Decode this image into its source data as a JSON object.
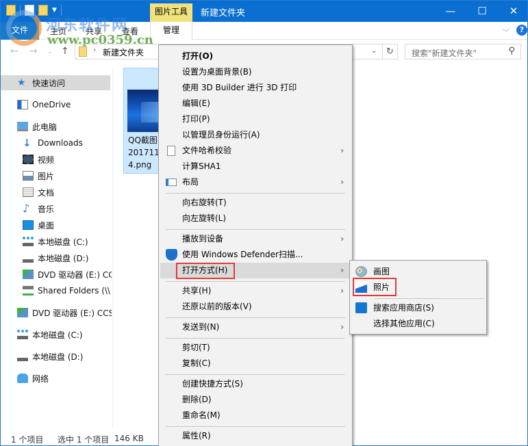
{
  "window": {
    "title": "新建文件夹",
    "contextual_tab_group": "图片工具",
    "controls": {
      "minimize": "—",
      "maximize": "☐",
      "close": "✕"
    }
  },
  "ribbon": {
    "tabs": [
      {
        "label": "文件"
      },
      {
        "label": "主页"
      },
      {
        "label": "共享"
      },
      {
        "label": "查看"
      },
      {
        "label": "管理"
      }
    ],
    "expand_icon": "chevron-down-icon",
    "help_label": "?"
  },
  "address_bar": {
    "path": [
      "新建文件夹"
    ],
    "separator": "›",
    "refresh": "↻",
    "search_placeholder": "搜索\"新建文件夹\""
  },
  "nav_pane": {
    "items": [
      {
        "label": "快速访问",
        "icon": "star-icon",
        "selected": true
      },
      {
        "label": "OneDrive",
        "icon": "onedrive-icon"
      },
      {
        "label": "此电脑",
        "icon": "computer-icon"
      },
      {
        "label": "Downloads",
        "icon": "download-icon"
      },
      {
        "label": "视频",
        "icon": "video-icon"
      },
      {
        "label": "图片",
        "icon": "pictures-icon"
      },
      {
        "label": "文档",
        "icon": "documents-icon"
      },
      {
        "label": "音乐",
        "icon": "music-icon"
      },
      {
        "label": "桌面",
        "icon": "desktop-icon"
      },
      {
        "label": "本地磁盘 (C:)",
        "icon": "system-drive-icon"
      },
      {
        "label": "本地磁盘 (D:)",
        "icon": "drive-icon"
      },
      {
        "label": "DVD 驱动器 (E:) CC",
        "icon": "dvd-icon"
      },
      {
        "label": "Shared Folders (\\\\",
        "icon": "network-drive-icon"
      },
      {
        "label": "DVD 驱动器 (E:) CCS",
        "icon": "dvd-icon"
      },
      {
        "label": "本地磁盘 (C:)",
        "icon": "system-drive-icon"
      },
      {
        "label": "本地磁盘 (D:)",
        "icon": "drive-icon"
      },
      {
        "label": "网络",
        "icon": "network-icon"
      }
    ]
  },
  "files": [
    {
      "name_lines": [
        "QQ截图",
        "201711",
        "4.png"
      ],
      "selected": true
    }
  ],
  "status_bar": {
    "item_count": "1 个项目",
    "selected": "选中 1 个项目",
    "size": "146 KB"
  },
  "context_menu": {
    "items": [
      {
        "label": "打开(O)",
        "bold": true
      },
      {
        "label": "设置为桌面背景(B)"
      },
      {
        "label": "使用 3D Builder 进行 3D 打印"
      },
      {
        "label": "编辑(E)"
      },
      {
        "label": "打印(P)"
      },
      {
        "label": "以管理员身份运行(A)"
      },
      {
        "label": "文件哈希校验",
        "icon": "file-icon",
        "submenu": true
      },
      {
        "label": "计算SHA1"
      },
      {
        "label": "布局",
        "icon": "layout-icon",
        "submenu": true
      },
      {
        "label": "向右旋转(T)"
      },
      {
        "label": "向左旋转(L)"
      },
      {
        "label": "播放到设备",
        "submenu": true
      },
      {
        "label": "使用 Windows Defender扫描...",
        "icon": "defender-shield-icon"
      },
      {
        "label": "打开方式(H)",
        "submenu": true,
        "highlighted": true
      },
      {
        "label": "共享(H)",
        "submenu": true
      },
      {
        "label": "还原以前的版本(V)"
      },
      {
        "label": "发送到(N)",
        "submenu": true
      },
      {
        "label": "剪切(T)"
      },
      {
        "label": "复制(C)"
      },
      {
        "label": "创建快捷方式(S)"
      },
      {
        "label": "删除(D)"
      },
      {
        "label": "重命名(M)"
      },
      {
        "label": "属性(R)"
      }
    ],
    "submenu_arrow": "›"
  },
  "open_with_submenu": {
    "items": [
      {
        "label": "画图",
        "icon": "paint-icon"
      },
      {
        "label": "照片",
        "icon": "photos-icon",
        "highlighted": true
      },
      {
        "label": "搜索应用商店(S)",
        "icon": "store-icon"
      },
      {
        "label": "选择其他应用(C)"
      }
    ]
  },
  "watermark": {
    "title": "河东软件网",
    "url": "www.pc0359.cn"
  },
  "colors": {
    "titlebar": "#0a6fd1",
    "contextual_tab": "#f1e27d",
    "selection": "#cce8ff",
    "menu_bg": "#f2f2f2",
    "highlight_border": "#e0393b"
  }
}
